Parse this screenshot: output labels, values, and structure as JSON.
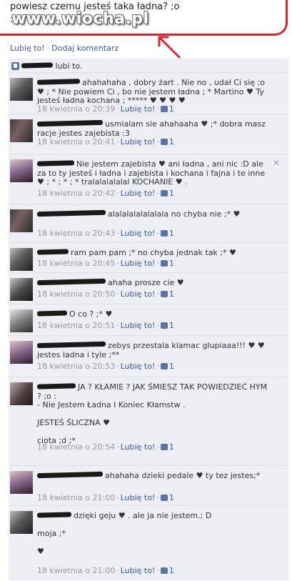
{
  "post": {
    "text_line1": "powiesz czemu jesteś taka ładna? ;o",
    "text_line2": ":o",
    "watermark": "www.wiocha.pl"
  },
  "actions": {
    "like": "Lubię to!",
    "separator": "·",
    "add_comment": "Dodaj komentarz"
  },
  "likes": {
    "text": "lubi to."
  },
  "comments": [
    {
      "text": "ahahahaha , dobry żart . Nie no , udał Ci się ;o ♥ ; * Nie powiem Ci , bo nie jestem ładna ; * Martino ♥ Ty jesteś ładna kochana ; ***** ♥ ♥ ♥ ♥",
      "time": "18 kwietnia o 20:39",
      "like": "Lubię to!",
      "likes": "1"
    },
    {
      "text": "usmialam sie ahahaaha ♥ ;* dobra masz racje jestes zajebista :3",
      "time": "18 kwietnia o 20:41",
      "like": "Lubię to!",
      "likes": "1"
    },
    {
      "text": "Nie jestem zajebista ♥ ani ładna , ani nic :D ale za to ty jesteś i ładna i zajebista i kochana i fajna i te inne ♥ ; * ; * ; * tralalalalalal KOCHANIE ♥ .",
      "time": "18 kwietnia o 20:42",
      "like": "Lubię to!",
      "likes": "1",
      "close": "✕"
    },
    {
      "text": "alalalalalalalala no chyba nie ;* ♥",
      "time": "18 kwietnia o 20:43",
      "like": "Lubię to!",
      "likes": "1"
    },
    {
      "text": "ram pam pam ;* no chyba jednak tak ;* ♥",
      "time": "18 kwietnia o 20:45",
      "like": "Lubię to!",
      "likes": "1"
    },
    {
      "text": "ahaha prosze cie ♥",
      "time": "18 kwietnia o 20:50",
      "like": "Lubię to!",
      "likes": "1"
    },
    {
      "text": "O co ? ;* ♥",
      "time": "18 kwietnia o 20:51",
      "like": "Lubię to!",
      "likes": "1"
    },
    {
      "text": "zebys przestala klamac glupiaaa!!! ♥ ♥ jestes ladna i tyle ;**",
      "time": "18 kwietnia o 20:53",
      "like": "Lubię to!",
      "likes": "1"
    },
    {
      "text_lines": [
        "JA ? KŁAMIE ? JAK ŚMIESZ TAK POWIEDZIEĆ HYM ? ;o :",
        "- Nie Jestem Ładna I Koniec Kłamstw .",
        "",
        "JESTEŚ ŚLICZNA ♥",
        "",
        "ciota ;d ;*"
      ],
      "time": "18 kwietnia o 20:54",
      "like": "Lubię to!",
      "likes": "1"
    },
    {
      "text": "ahahaha dzieki pedale ♥ ty tez jestes;*",
      "time": "18 kwietnia o 21:00",
      "like": "Lubię to!",
      "likes": "1"
    },
    {
      "text_lines": [
        "dzięki geju ♥ . ale ja nie jestem.; D",
        "",
        "moja ;*",
        "",
        "♥"
      ],
      "time": "18 kwietnia o 21:00",
      "like": "Lubię to!",
      "likes": "1"
    }
  ]
}
